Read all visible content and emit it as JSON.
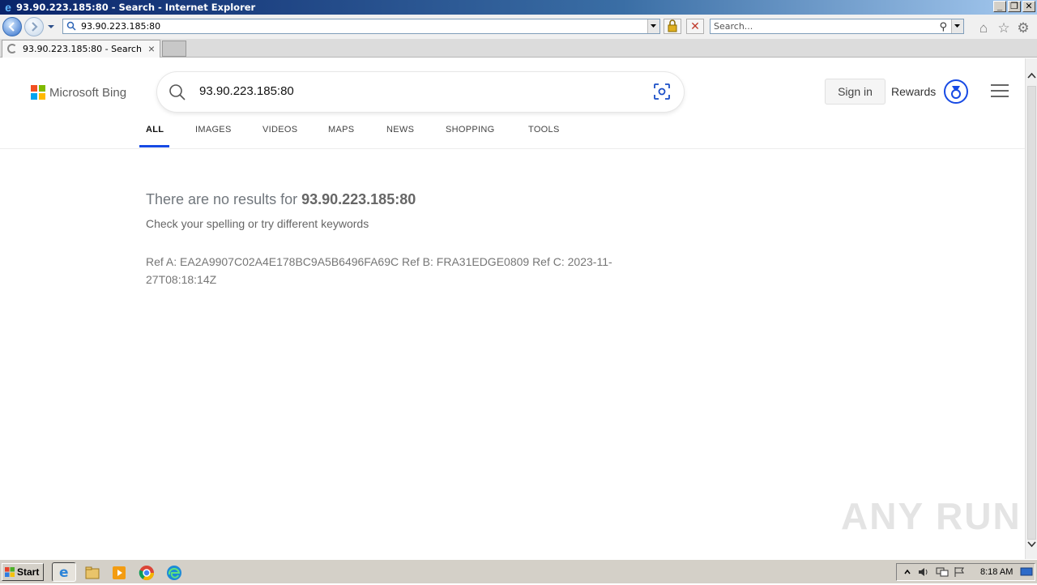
{
  "window": {
    "title": "93.90.223.185:80 - Search - Internet Explorer",
    "controls": [
      "_",
      "❐",
      "✕"
    ]
  },
  "address_bar": {
    "url": "93.90.223.185:80",
    "search_placeholder": "Search..."
  },
  "tabs": [
    {
      "label": "93.90.223.185:80 - Search",
      "loading": true
    }
  ],
  "bing": {
    "brand": "Microsoft Bing",
    "query": "93.90.223.185:80",
    "sign_in": "Sign in",
    "rewards": "Rewards",
    "nav": [
      {
        "label": "ALL",
        "active": true
      },
      {
        "label": "IMAGES"
      },
      {
        "label": "VIDEOS"
      },
      {
        "label": "MAPS"
      },
      {
        "label": "NEWS"
      },
      {
        "label": "SHOPPING"
      },
      {
        "label": "TOOLS"
      }
    ],
    "no_results_prefix": "There are no results for ",
    "no_results_query": "93.90.223.185:80",
    "hint": "Check your spelling or try different keywords",
    "refs": "Ref A: EA2A9907C02A4E178BC9A5B6496FA69C Ref B: FRA31EDGE0809 Ref C: 2023-11-27T08:18:14Z",
    "accent_color": "#174ae4"
  },
  "watermark": "ANY RUN",
  "taskbar": {
    "start": "Start",
    "clock": "8:18 AM"
  }
}
